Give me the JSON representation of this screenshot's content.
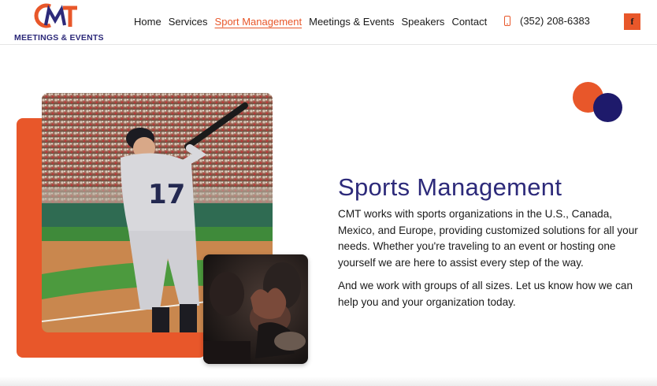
{
  "header": {
    "logo_letters": "CMT",
    "logo_subtitle": "MEETINGS & EVENTS",
    "nav": [
      {
        "label": "Home",
        "active": false
      },
      {
        "label": "Services",
        "active": false
      },
      {
        "label": "Sport Management",
        "active": true
      },
      {
        "label": "Meetings & Events",
        "active": false
      },
      {
        "label": "Speakers",
        "active": false
      },
      {
        "label": "Contact",
        "active": false
      }
    ],
    "phone": "(352) 208-6383",
    "phone_icon": "mobile-phone-icon",
    "social_icon": "facebook-icon",
    "social_label": "f"
  },
  "hero": {
    "title": "Sports Management",
    "paragraph_1": "CMT works with sports organizations in the U.S., Canada, Mexico, and Europe, providing customized solutions for all your needs. Whether you're traveling to an event or hosting one yourself we are here to assist every step of the way.",
    "paragraph_2": "And we work with groups of all sizes. Let us know how we can help you and your organization today.",
    "main_photo_jersey_number": "17"
  },
  "colors": {
    "accent_orange": "#e8572a",
    "brand_navy": "#2d2a7a",
    "navy_dark": "#1e1a6b"
  }
}
